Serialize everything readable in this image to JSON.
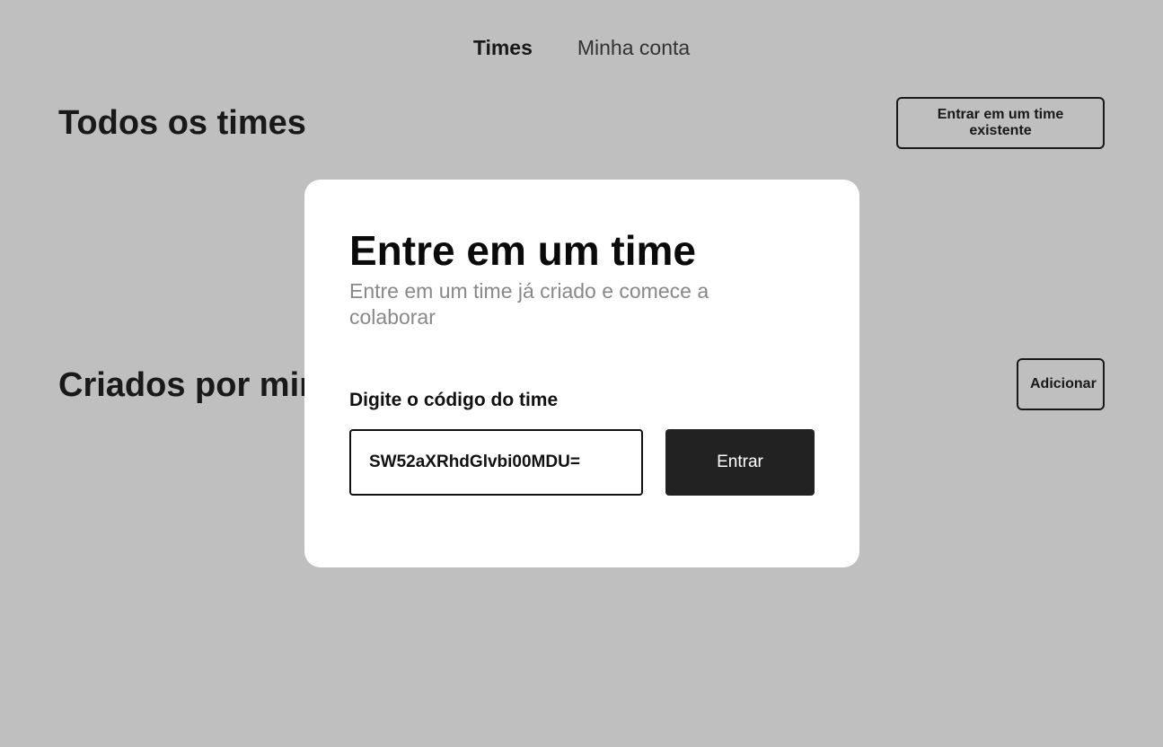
{
  "nav": {
    "items": [
      {
        "label": "Times",
        "active": true
      },
      {
        "label": "Minha conta",
        "active": false
      }
    ]
  },
  "sections": {
    "all_teams": {
      "title": "Todos os times",
      "button_label": "Entrar em um time existente"
    },
    "created_by_me": {
      "title": "Criados por mim",
      "button_label": "Adicionar"
    }
  },
  "modal": {
    "title": "Entre em um time",
    "subtitle": "Entre em um time já criado e comece a colaborar",
    "field_label": "Digite o código do time",
    "code_value": "SW52aXRhdGlvbi00MDU=",
    "submit_label": "Entrar"
  },
  "colors": {
    "overlay": "rgba(0,0,0,0.25)",
    "primary_button": "#222222",
    "modal_background": "#ffffff"
  }
}
